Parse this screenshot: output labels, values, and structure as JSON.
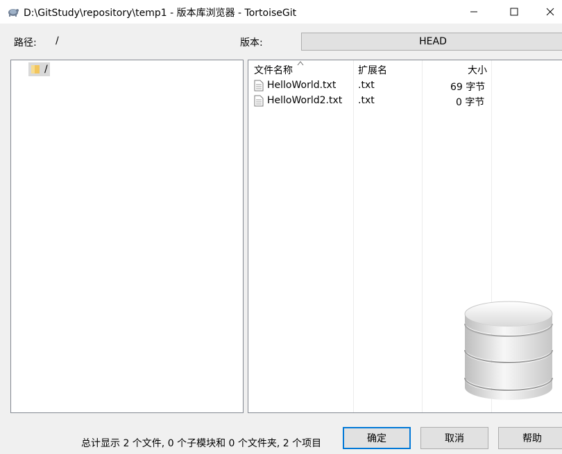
{
  "window": {
    "title": "D:\\GitStudy\\repository\\temp1 - 版本库浏览器 - TortoiseGit",
    "minimize_icon": "minimize-icon",
    "maximize_icon": "maximize-icon",
    "close_icon": "close-icon"
  },
  "toolbar": {
    "path_label": "路径:",
    "path_value": "/",
    "revision_label": "版本:",
    "revision_value": "HEAD"
  },
  "tree": {
    "root_label": "/"
  },
  "file_list": {
    "columns": [
      "文件名称",
      "扩展名",
      "大小"
    ],
    "sort_column": "文件名称",
    "rows": [
      {
        "name": "HelloWorld.txt",
        "ext": ".txt",
        "size": "69 字节"
      },
      {
        "name": "HelloWorld2.txt",
        "ext": ".txt",
        "size": "0 字节"
      }
    ]
  },
  "status": {
    "summary": "总计显示 2 个文件, 0 个子模块和 0 个文件夹, 2 个项目"
  },
  "buttons": {
    "ok": "确定",
    "cancel": "取消",
    "help": "帮助"
  },
  "colors": {
    "accent": "#0078d7",
    "button_bg": "#e1e1e1",
    "folder": "#f2c55c"
  }
}
